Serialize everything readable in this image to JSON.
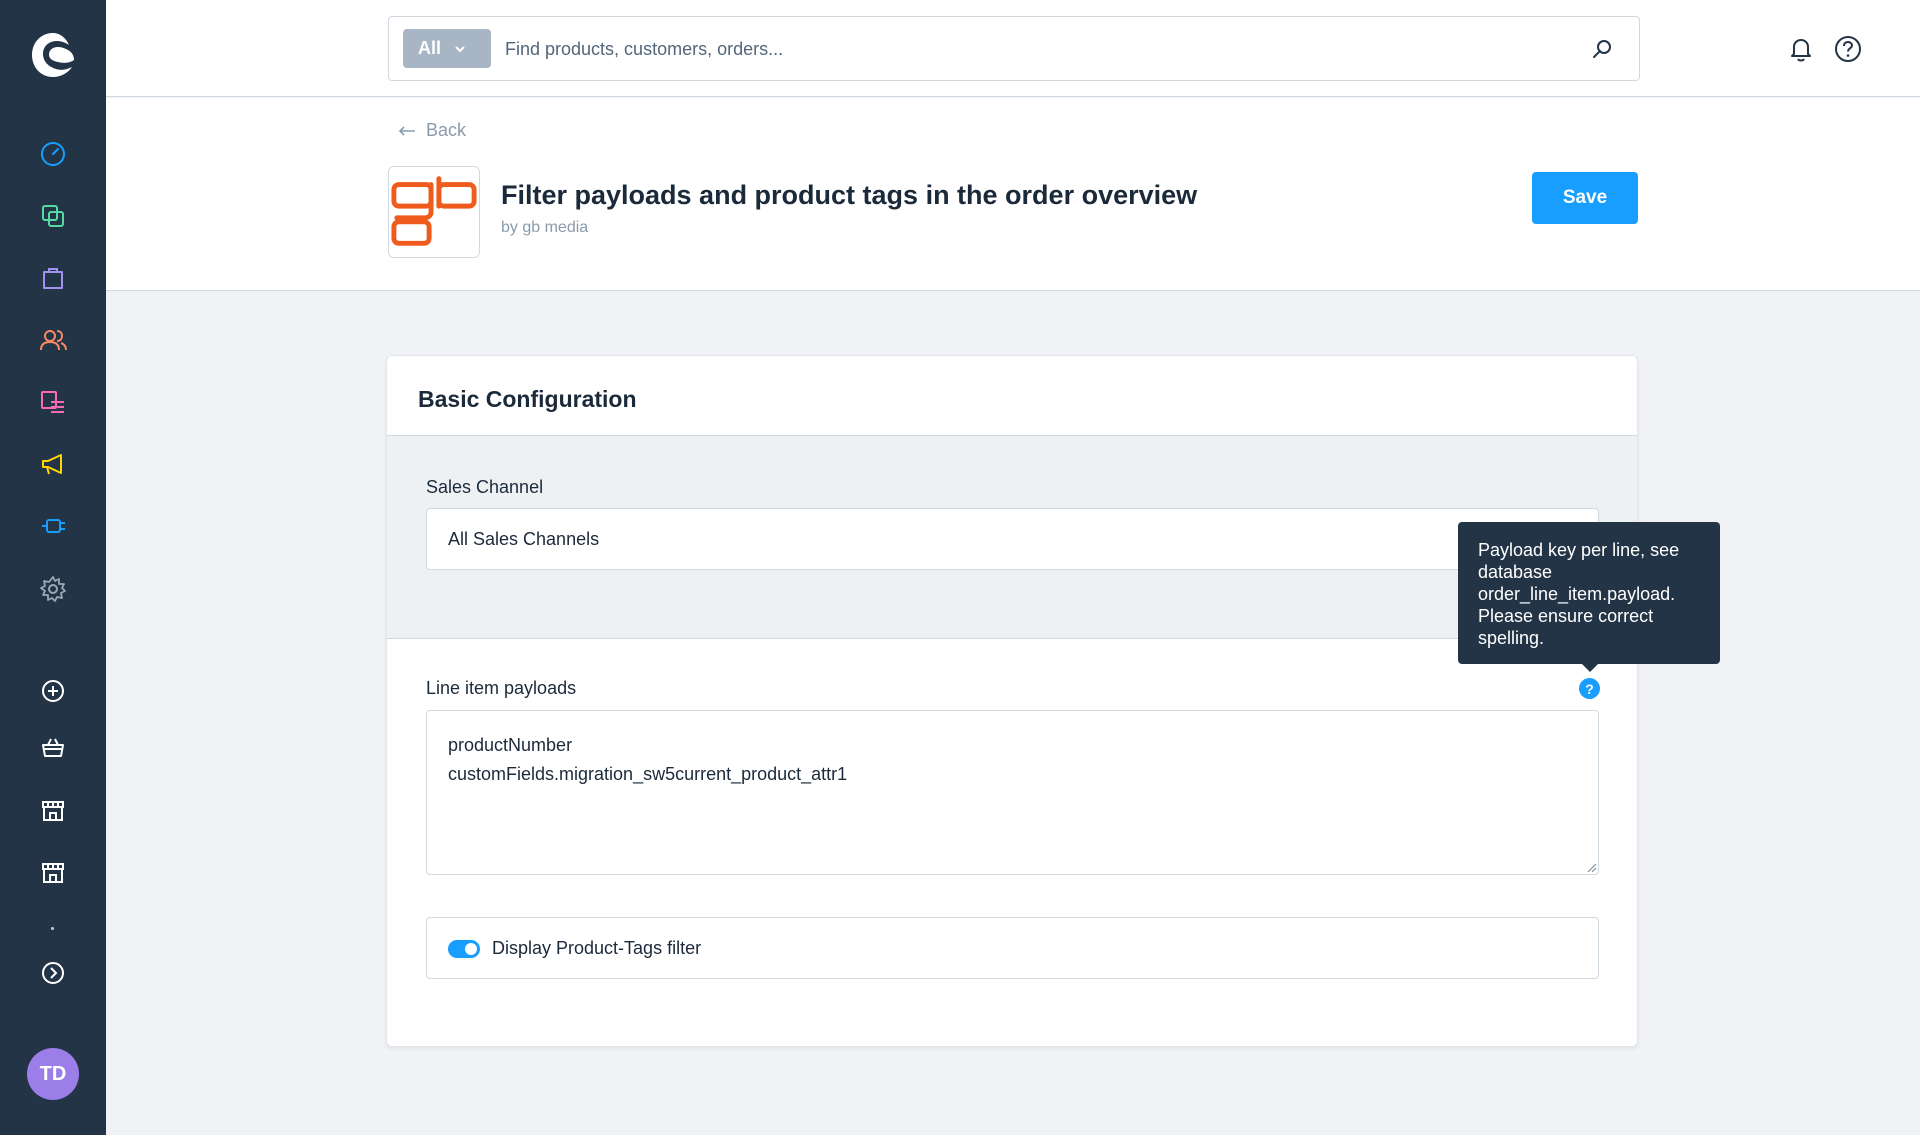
{
  "colors": {
    "sidebar": "#243447",
    "accent": "#189eff",
    "avatar": "#9b7ee8"
  },
  "sidebar": {
    "items": [
      {
        "icon": "dashboard-icon",
        "color": "#189eff"
      },
      {
        "icon": "catalogues-icon",
        "color": "#57d9a3"
      },
      {
        "icon": "orders-icon",
        "color": "#a092f0"
      },
      {
        "icon": "customers-icon",
        "color": "#f88962"
      },
      {
        "icon": "content-icon",
        "color": "#ff68b4"
      },
      {
        "icon": "marketing-icon",
        "color": "#ffd700"
      },
      {
        "icon": "extensions-icon",
        "color": "#189eff"
      },
      {
        "icon": "settings-icon",
        "color": "#9aa8b5"
      },
      {
        "icon": "add-circle-icon",
        "color": "#ffffff"
      },
      {
        "icon": "basket-icon",
        "color": "#ffffff"
      },
      {
        "icon": "storefront-icon",
        "color": "#ffffff"
      },
      {
        "icon": "storefront-icon",
        "color": "#ffffff"
      },
      {
        "icon": "expand-icon",
        "color": "#ffffff"
      }
    ],
    "avatar_initials": "TD"
  },
  "search": {
    "type_label": "All",
    "placeholder": "Find products, customers, orders..."
  },
  "header": {
    "back_label": "Back",
    "title": "Filter payloads and product tags in the order overview",
    "author": "by gb media",
    "save_label": "Save"
  },
  "card": {
    "title": "Basic Configuration",
    "sales_channel_label": "Sales Channel",
    "sales_channel_value": "All Sales Channels",
    "payloads_label": "Line item payloads",
    "payloads_value": "productNumber\ncustomFields.migration_sw5current_product_attr1",
    "help_mark": "?",
    "toggle_label": "Display Product-Tags filter",
    "toggle_on": true
  },
  "tooltip": {
    "text": "Payload key per line, see database order_line_item.payload. Please ensure correct spelling."
  }
}
